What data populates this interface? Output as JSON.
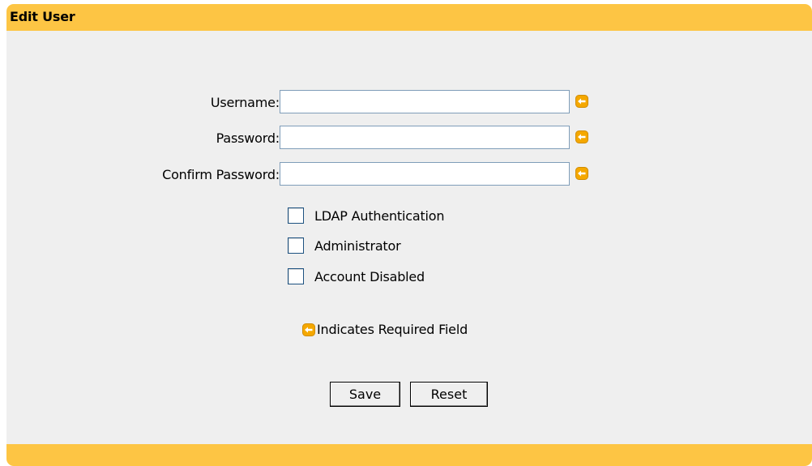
{
  "panel": {
    "title": "Edit User"
  },
  "form": {
    "username": {
      "label": "Username:",
      "value": "",
      "placeholder": ""
    },
    "password": {
      "label": "Password:",
      "value": "",
      "placeholder": ""
    },
    "confirm_password": {
      "label": "Confirm Password:",
      "value": "",
      "placeholder": ""
    },
    "checkboxes": [
      {
        "label": "LDAP Authentication",
        "checked": false
      },
      {
        "label": "Administrator",
        "checked": false
      },
      {
        "label": "Account Disabled",
        "checked": false
      }
    ],
    "required_legend": "Indicates Required Field",
    "save_label": "Save",
    "reset_label": "Reset"
  },
  "icons": {
    "required": "required-field-arrow-icon"
  },
  "colors": {
    "header_bar": "#fdc544",
    "panel_background": "#efefef",
    "required_icon": "#f5a800",
    "input_border": "#7f9db9"
  }
}
